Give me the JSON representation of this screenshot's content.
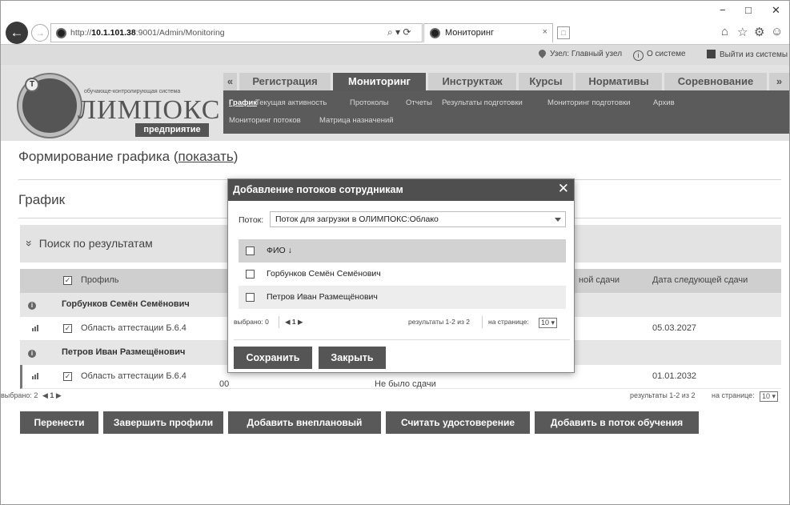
{
  "browser": {
    "url_prefix": "http://",
    "url_host": "10.1.101.38",
    "url_path": ":9001/Admin/Monitoring",
    "search_glyph": "⌕ ▾ ⟳",
    "tab_title": "Мониторинг",
    "tab_close": "×",
    "newtab": "□",
    "back": "←",
    "forward": "→",
    "minimize": "−",
    "maximize": "□",
    "close": "✕",
    "tool_home": "⌂",
    "tool_star": "☆",
    "tool_gear": "⚙",
    "tool_smile": "☺"
  },
  "topbar": {
    "node": "Узел: Главный узел",
    "about": "О системе",
    "logout": "Выйти из системы"
  },
  "logo": {
    "tagline": "обучающе-контролирующая система",
    "name": "ЛИМПОКС",
    "sub": "предприятие",
    "t": "Т"
  },
  "main_nav": {
    "prev": "«",
    "next": "»",
    "items": [
      "Регистрация",
      "Мониторинг",
      "Инструктаж",
      "Курсы",
      "Нормативы",
      "Соревнование"
    ]
  },
  "sub_nav": {
    "items": [
      "График",
      "Текущая активность",
      "Протоколы",
      "Отчеты",
      "Результаты подготовки",
      "Мониторинг подготовки",
      "Архив",
      "Мониторинг потоков",
      "Матрица назначений"
    ]
  },
  "page": {
    "title_prefix": "Формирование графика (",
    "title_link": "показать",
    "title_suffix": ")",
    "section": "График",
    "search_label": "Поиск по результатам",
    "search_chevron": "»"
  },
  "table": {
    "headers": [
      "Профиль",
      "ной сдачи",
      "Дата следующей сдачи"
    ],
    "rows": [
      {
        "type": "group",
        "name": "Горбунков Семён Семёнович"
      },
      {
        "type": "item",
        "profile": "Область аттестации Б.6.4",
        "next_date": "05.03.2027"
      },
      {
        "type": "group",
        "name": "Петров Иван Размещёнович"
      },
      {
        "type": "item",
        "profile": "Область аттестации Б.6.4",
        "left": "00",
        "status": "Не было сдачи",
        "next_date": "01.01.2032"
      }
    ],
    "selected": "выбрано: 2",
    "pager": "◀ 1 ▶",
    "results": "результаты 1-2 из 2",
    "per_page_label": "на странице:",
    "per_page": "10 ▾"
  },
  "actions": [
    "Перенести",
    "Завершить профили",
    "Добавить внеплановый",
    "Считать удостоверение",
    "Добавить в поток обучения"
  ],
  "modal": {
    "title": "Добавление потоков сотрудникам",
    "close": "✕",
    "stream_label": "Поток:",
    "stream_value": "Поток для загрузки в ОЛИМПОКС:Облако",
    "column": "ФИО ↓",
    "people": [
      "Горбунков Семён Семёнович",
      "Петров Иван Размещёнович"
    ],
    "selected": "выбрано: 0",
    "pager": "◀ 1 ▶",
    "results": "результаты 1-2 из 2",
    "per_page_label": "на странице:",
    "per_page": "10 ▾",
    "save": "Сохранить",
    "cancel": "Закрыть"
  }
}
